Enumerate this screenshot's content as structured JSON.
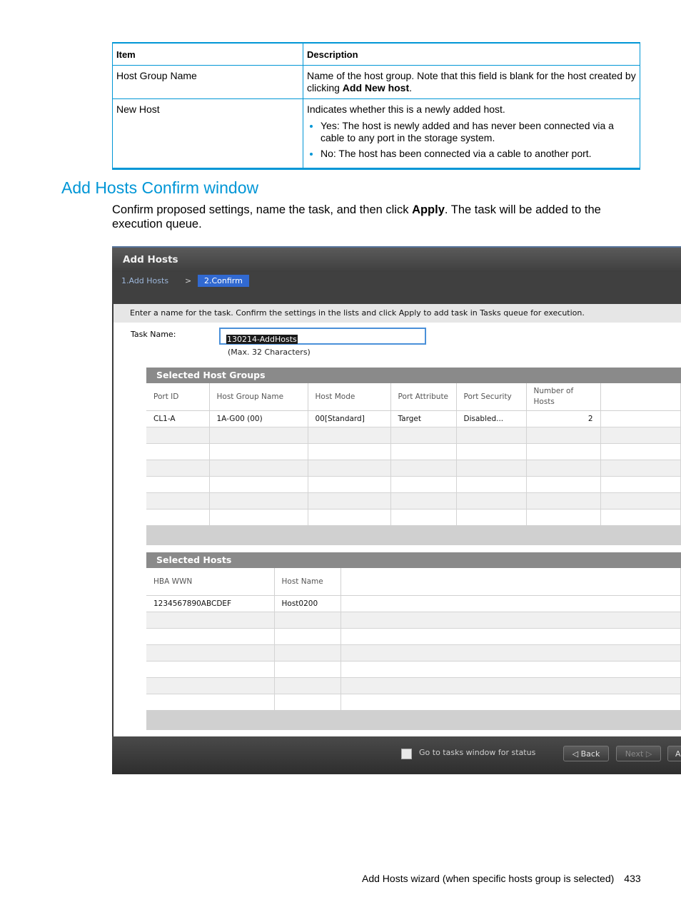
{
  "desc_table": {
    "headers": [
      "Item",
      "Description"
    ],
    "rows": [
      {
        "item": "Host Group Name",
        "desc_pre": "Name of the host group. Note that this field is blank for the host created by clicking ",
        "desc_bold": "Add New host",
        "desc_post": "."
      },
      {
        "item": "New Host",
        "desc": "Indicates whether this is a newly added host.",
        "bullets": [
          "Yes: The host is newly added and has never been connected via a cable to any port in the storage system.",
          "No: The host has been connected via a cable to another port."
        ]
      }
    ]
  },
  "section": {
    "title": "Add Hosts Confirm window",
    "intro_pre": "Confirm proposed settings, name the task, and then click ",
    "intro_bold": "Apply",
    "intro_post": ". The task will be added to the execution queue."
  },
  "dialog": {
    "title": "Add Hosts",
    "step1": "1.Add Hosts",
    "step_sep": ">",
    "step2": "2.Confirm",
    "instruction": "Enter a name for the task. Confirm the settings in the lists and click Apply to add task in Tasks queue for execution.",
    "task_label": "Task Name:",
    "task_value": "130214-AddHosts",
    "task_hint": "(Max. 32 Characters)",
    "host_groups": {
      "title": "Selected Host Groups",
      "columns": [
        "Port ID",
        "Host Group Name",
        "Host Mode",
        "Port Attribute",
        "Port Security",
        "Number of Hosts",
        ""
      ],
      "rows": [
        [
          "CL1-A",
          "1A-G00 (00)",
          "00[Standard]",
          "Target",
          "Disabled...",
          "2",
          ""
        ]
      ]
    },
    "hosts": {
      "title": "Selected Hosts",
      "columns": [
        "HBA WWN",
        "Host Name",
        ""
      ],
      "rows": [
        [
          "1234567890ABCDEF",
          "Host0200",
          ""
        ]
      ]
    },
    "checkbox_label": "Go to tasks window for status",
    "back_label": "◁ Back",
    "next_label": "Next ▷",
    "apply_label": "A"
  },
  "footer": {
    "text": "Add Hosts wizard (when specific hosts group is selected)",
    "page": "433"
  }
}
